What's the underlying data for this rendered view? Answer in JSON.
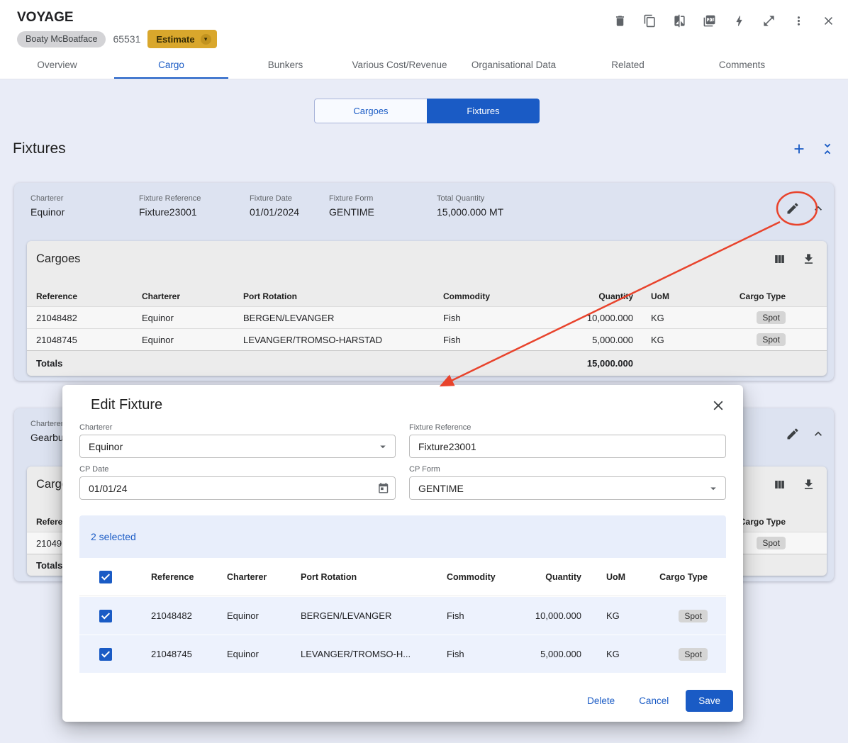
{
  "colors": {
    "primary": "#1a5bc5",
    "estimate_amber": "#d9a72c",
    "annotation_red": "#e8432c",
    "card_bg": "#dde3f1"
  },
  "header": {
    "title": "VOYAGE",
    "vessel_chip": "Boaty McBoatface",
    "voyage_number": "65531",
    "estimate_button": "Estimate",
    "action_icons": [
      "delete-icon",
      "copy-icon",
      "compare-icon",
      "pdf-icon",
      "bolt-icon",
      "expand-icon",
      "more-vert-icon",
      "close-icon"
    ]
  },
  "tabs": [
    "Overview",
    "Cargo",
    "Bunkers",
    "Various Cost/Revenue",
    "Organisational Data",
    "Related",
    "Comments"
  ],
  "active_tab": "Cargo",
  "toggle": {
    "cargoes": "Cargoes",
    "fixtures": "Fixtures",
    "selected": "Fixtures"
  },
  "fixtures_title": "Fixtures",
  "card1": {
    "charterer_label": "Charterer",
    "charterer": "Equinor",
    "fixture_reference_label": "Fixture Reference",
    "fixture_reference": "Fixture23001",
    "fixture_date_label": "Fixture Date",
    "fixture_date": "01/01/2024",
    "fixture_form_label": "Fixture Form",
    "fixture_form": "GENTIME",
    "total_quantity_label": "Total Quantity",
    "total_quantity": "15,000.000 MT",
    "cargoes_title": "Cargoes",
    "columns": [
      "Reference",
      "Charterer",
      "Port Rotation",
      "Commodity",
      "Quantity",
      "UoM",
      "Cargo Type"
    ],
    "rows": [
      {
        "reference": "21048482",
        "charterer": "Equinor",
        "port_rotation": "BERGEN/LEVANGER",
        "commodity": "Fish",
        "quantity": "10,000.000",
        "uom": "KG",
        "cargo_type": "Spot"
      },
      {
        "reference": "21048745",
        "charterer": "Equinor",
        "port_rotation": "LEVANGER/TROMSO-HARSTAD",
        "commodity": "Fish",
        "quantity": "5,000.000",
        "uom": "KG",
        "cargo_type": "Spot"
      }
    ],
    "totals_label": "Totals",
    "totals_quantity": "15,000.000"
  },
  "card2": {
    "charterer_label": "Charterer",
    "charterer": "Gearbu",
    "cargoes_title": "Cargoes",
    "reference_column": "Reference",
    "cargo_type_column": "Cargo Type",
    "row_reference": "21049",
    "row_cargo_type": "Spot",
    "totals_label": "Totals"
  },
  "modal": {
    "title": "Edit Fixture",
    "charterer_label": "Charterer",
    "charterer": "Equinor",
    "fixture_reference_label": "Fixture Reference",
    "fixture_reference": "Fixture23001",
    "cp_date_label": "CP Date",
    "cp_date": "01/01/24",
    "cp_form_label": "CP Form",
    "cp_form": "GENTIME",
    "selected_text": "2 selected",
    "columns": [
      "Reference",
      "Charterer",
      "Port Rotation",
      "Commodity",
      "Quantity",
      "UoM",
      "Cargo Type"
    ],
    "rows": [
      {
        "reference": "21048482",
        "charterer": "Equinor",
        "port_rotation": "BERGEN/LEVANGER",
        "commodity": "Fish",
        "quantity": "10,000.000",
        "uom": "KG",
        "cargo_type": "Spot"
      },
      {
        "reference": "21048745",
        "charterer": "Equinor",
        "port_rotation": "LEVANGER/TROMSO-H...",
        "commodity": "Fish",
        "quantity": "5,000.000",
        "uom": "KG",
        "cargo_type": "Spot"
      }
    ],
    "delete_button": "Delete",
    "cancel_button": "Cancel",
    "save_button": "Save"
  }
}
